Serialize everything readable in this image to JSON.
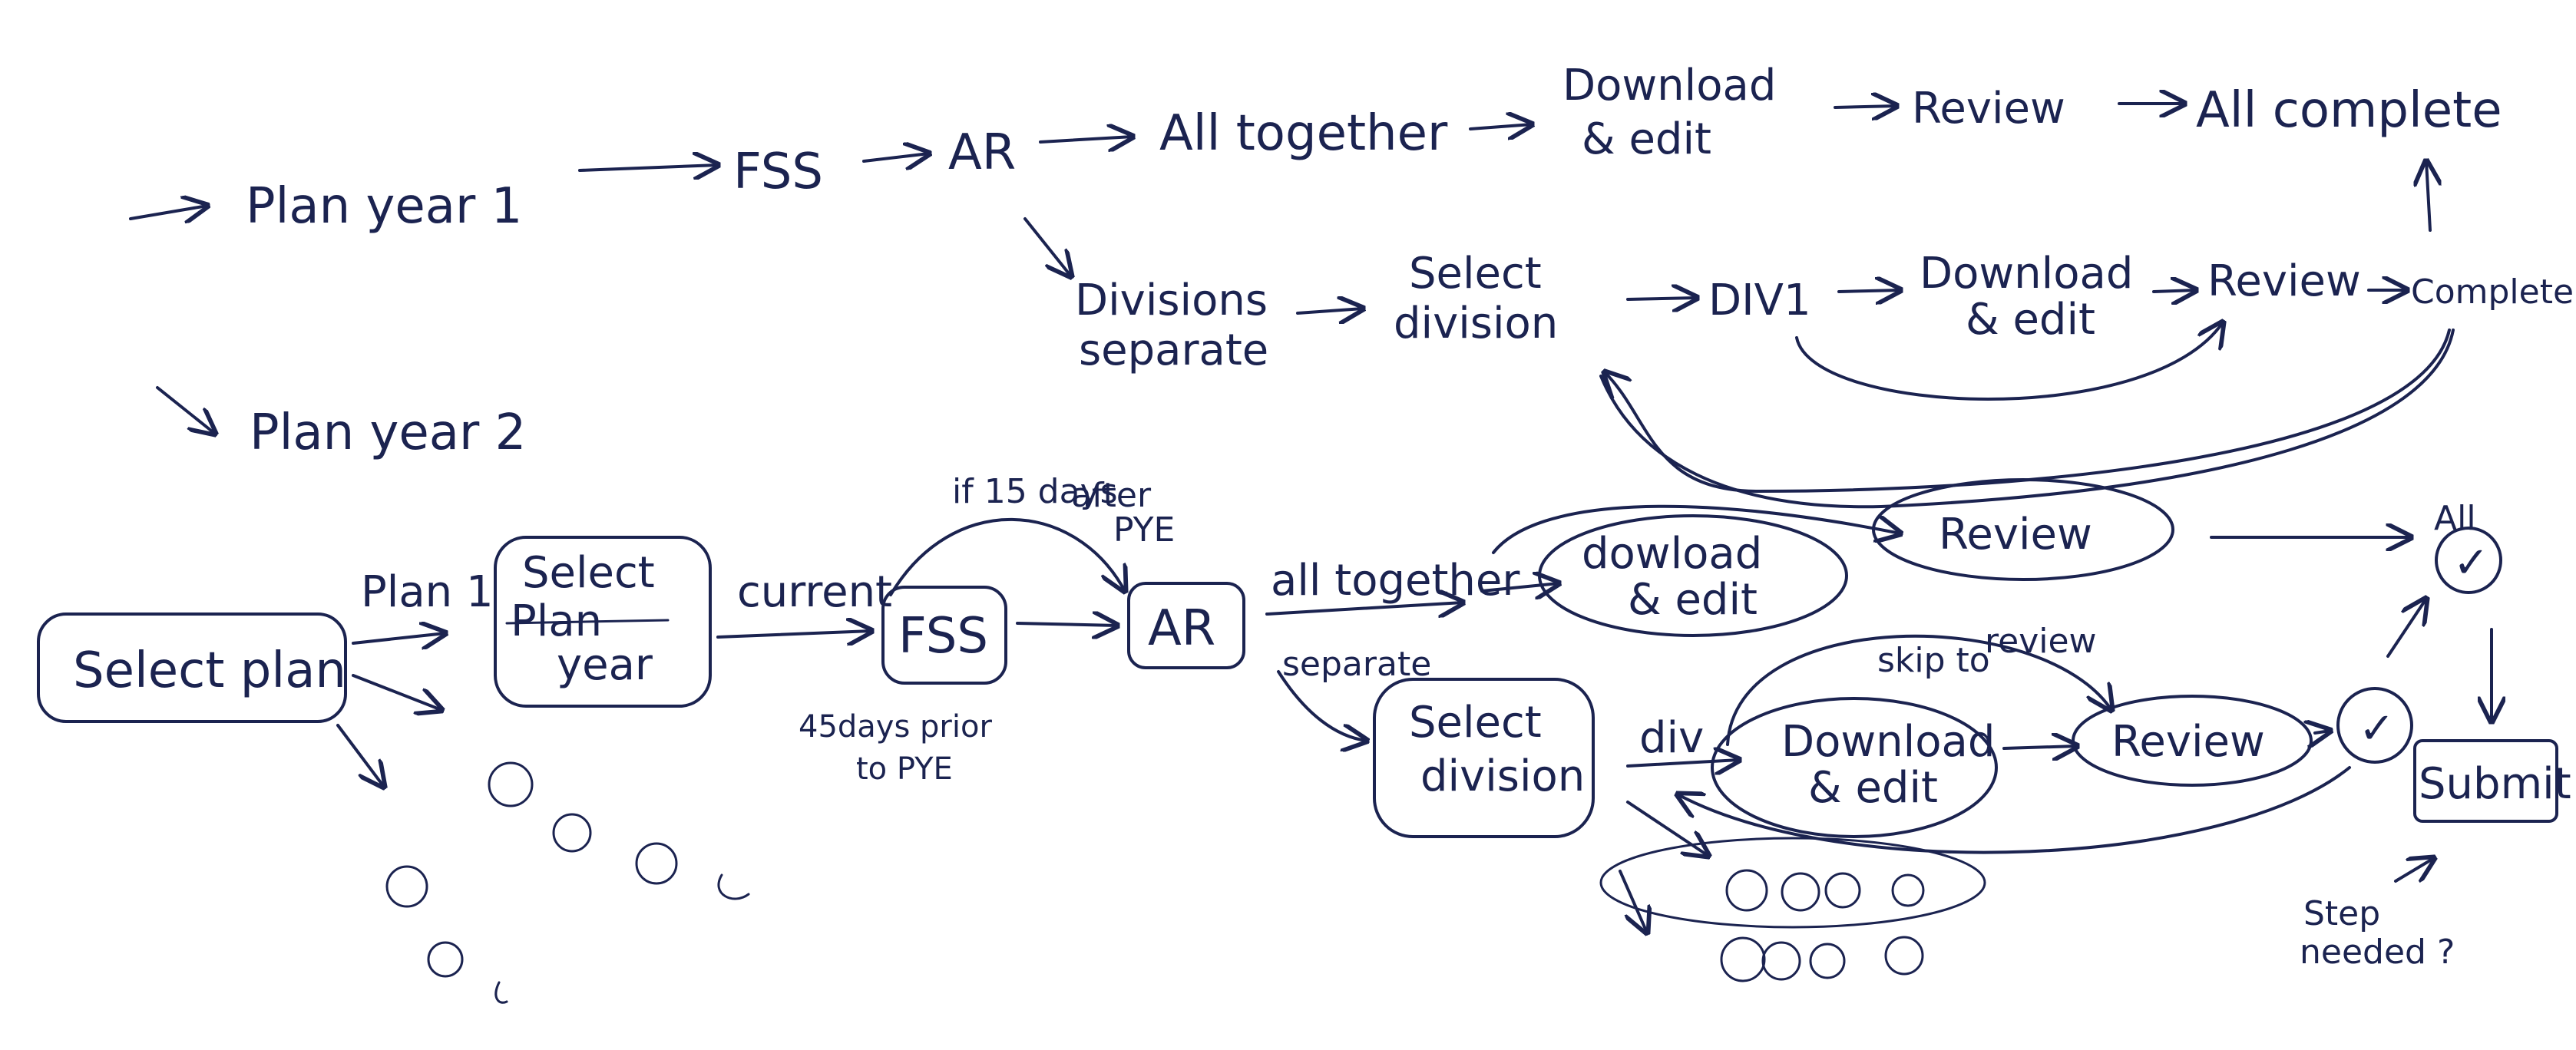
{
  "top_flow": {
    "plan_year_1": "Plan year 1",
    "fss": "FSS",
    "ar": "AR",
    "all_together": "All together",
    "download_edit_line1": "Download",
    "download_edit_line2": "& edit",
    "review": "Review",
    "all_complete": "All complete"
  },
  "divisions_flow": {
    "divisions_line1": "Divisions",
    "divisions_line2": "separate",
    "select_division_line1": "Select",
    "select_division_line2": "division",
    "div1": "DIV1",
    "download_edit_line1": "Download",
    "download_edit_line2": "& edit",
    "review": "Review",
    "complete": "Complete"
  },
  "plan_year_2": "Plan year 2",
  "bottom_flow": {
    "select_plan": "Select plan",
    "plan1_label": "Plan 1",
    "select_line1": "Select",
    "plan_struck": "Plan",
    "year": "year",
    "current_label": "current",
    "fss": "FSS",
    "fss_note_line1": "45days prior",
    "fss_note_line2": "to PYE",
    "if15_line1": "if 15 days",
    "if15_line2": "after",
    "if15_line3": "PYE",
    "ar": "AR",
    "all_together_label": "all together",
    "separate_label": "separate",
    "download_edit_line1": "dowload",
    "download_edit_line2": "& edit",
    "review_top": "Review",
    "all_label": "All",
    "check": "✓",
    "select_division_line1": "Select",
    "select_division_line2": "division",
    "div_label": "div",
    "download_edit2_line1": "Download",
    "download_edit2_line2": "& edit",
    "skip_line1": "skip to",
    "skip_line2": "review",
    "review_bottom": "Review",
    "check2": "✓",
    "submit": "Submit",
    "step_line1": "Step",
    "step_line2": "needed ?"
  }
}
